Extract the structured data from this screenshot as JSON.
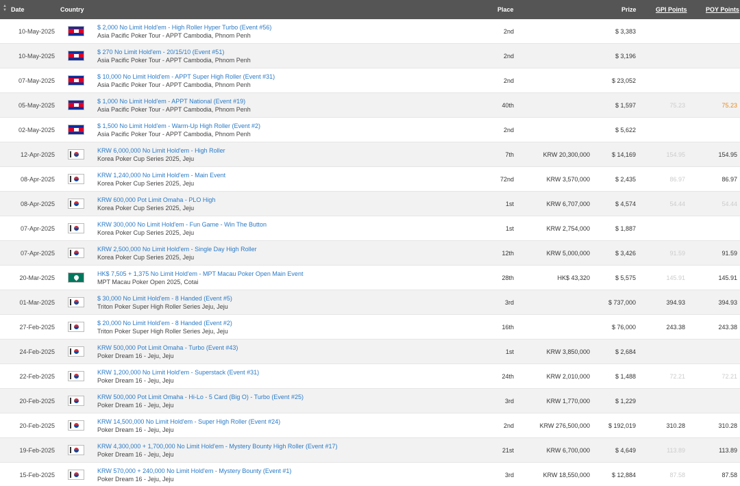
{
  "header": {
    "date": "Date",
    "country": "Country",
    "place": "Place",
    "prize": "Prize",
    "gpi": "GPI Points",
    "poy": "POY Points"
  },
  "rows": [
    {
      "date": "10-May-2025",
      "flag": "kh",
      "event": "$ 2,000 No Limit Hold'em - High Roller Hyper Turbo (Event #56)",
      "tour": "Asia Pacific Poker Tour - APPT Cambodia, Phnom Penh",
      "place": "2nd",
      "local": "",
      "prize": "$ 3,383",
      "gpi": "",
      "poy": ""
    },
    {
      "date": "10-May-2025",
      "flag": "kh",
      "event": "$ 270 No Limit Hold'em - 20/15/10 (Event #51)",
      "tour": "Asia Pacific Poker Tour - APPT Cambodia, Phnom Penh",
      "place": "2nd",
      "local": "",
      "prize": "$ 3,196",
      "gpi": "",
      "poy": ""
    },
    {
      "date": "07-May-2025",
      "flag": "kh",
      "event": "$ 10,000 No Limit Hold'em - APPT Super High Roller (Event #31)",
      "tour": "Asia Pacific Poker Tour - APPT Cambodia, Phnom Penh",
      "place": "2nd",
      "local": "",
      "prize": "$ 23,052",
      "gpi": "",
      "poy": ""
    },
    {
      "date": "05-May-2025",
      "flag": "kh",
      "event": "$ 1,000 No Limit Hold'em - APPT National (Event #19)",
      "tour": "Asia Pacific Poker Tour - APPT Cambodia, Phnom Penh",
      "place": "40th",
      "local": "",
      "prize": "$ 1,597",
      "gpi": "75.23",
      "gpi_faded": true,
      "poy": "75.23",
      "poy_orange": true
    },
    {
      "date": "02-May-2025",
      "flag": "kh",
      "event": "$ 1,500 No Limit Hold'em - Warm-Up High Roller (Event #2)",
      "tour": "Asia Pacific Poker Tour - APPT Cambodia, Phnom Penh",
      "place": "2nd",
      "local": "",
      "prize": "$ 5,622",
      "gpi": "",
      "poy": ""
    },
    {
      "date": "12-Apr-2025",
      "flag": "kr",
      "event": "KRW 6,000,000 No Limit Hold'em - High Roller",
      "tour": "Korea Poker Cup Series 2025, Jeju",
      "place": "7th",
      "local": "KRW 20,300,000",
      "prize": "$ 14,169",
      "gpi": "154.95",
      "gpi_faded": true,
      "poy": "154.95"
    },
    {
      "date": "08-Apr-2025",
      "flag": "kr",
      "event": "KRW 1,240,000 No Limit Hold'em - Main Event",
      "tour": "Korea Poker Cup Series 2025, Jeju",
      "place": "72nd",
      "local": "KRW 3,570,000",
      "prize": "$ 2,435",
      "gpi": "86.97",
      "gpi_faded": true,
      "poy": "86.97"
    },
    {
      "date": "08-Apr-2025",
      "flag": "kr",
      "event": "KRW 600,000 Pot Limit Omaha - PLO High",
      "tour": "Korea Poker Cup Series 2025, Jeju",
      "place": "1st",
      "local": "KRW 6,707,000",
      "prize": "$ 4,574",
      "gpi": "54.44",
      "gpi_faded": true,
      "poy": "54.44",
      "poy_faded": true
    },
    {
      "date": "07-Apr-2025",
      "flag": "kr",
      "event": "KRW 300,000 No Limit Hold'em - Fun Game - Win The Button",
      "tour": "Korea Poker Cup Series 2025, Jeju",
      "place": "1st",
      "local": "KRW 2,754,000",
      "prize": "$ 1,887",
      "gpi": "",
      "poy": ""
    },
    {
      "date": "07-Apr-2025",
      "flag": "kr",
      "event": "KRW 2,500,000 No Limit Hold'em - Single Day High Roller",
      "tour": "Korea Poker Cup Series 2025, Jeju",
      "place": "12th",
      "local": "KRW 5,000,000",
      "prize": "$ 3,426",
      "gpi": "91.59",
      "gpi_faded": true,
      "poy": "91.59"
    },
    {
      "date": "20-Mar-2025",
      "flag": "mo",
      "event": "HK$ 7,505 + 1,375 No Limit Hold'em - MPT Macau Poker Open Main Event",
      "tour": "MPT Macau Poker Open 2025, Cotai",
      "place": "28th",
      "local": "HK$ 43,320",
      "prize": "$ 5,575",
      "gpi": "145.91",
      "gpi_faded": true,
      "poy": "145.91"
    },
    {
      "date": "01-Mar-2025",
      "flag": "kr",
      "event": "$ 30,000 No Limit Hold'em - 8 Handed (Event #5)",
      "tour": "Triton Poker Super High Roller Series Jeju, Jeju",
      "place": "3rd",
      "local": "",
      "prize": "$ 737,000",
      "gpi": "394.93",
      "poy": "394.93"
    },
    {
      "date": "27-Feb-2025",
      "flag": "kr",
      "event": "$ 20,000 No Limit Hold'em - 8 Handed (Event #2)",
      "tour": "Triton Poker Super High Roller Series Jeju, Jeju",
      "place": "16th",
      "local": "",
      "prize": "$ 76,000",
      "gpi": "243.38",
      "poy": "243.38"
    },
    {
      "date": "24-Feb-2025",
      "flag": "kr",
      "event": "KRW 500,000 Pot Limit Omaha - Turbo (Event #43)",
      "tour": "Poker Dream 16 - Jeju, Jeju",
      "place": "1st",
      "local": "KRW 3,850,000",
      "prize": "$ 2,684",
      "gpi": "",
      "poy": ""
    },
    {
      "date": "22-Feb-2025",
      "flag": "kr",
      "event": "KRW 1,200,000 No Limit Hold'em - Superstack (Event #31)",
      "tour": "Poker Dream 16 - Jeju, Jeju",
      "place": "24th",
      "local": "KRW 2,010,000",
      "prize": "$ 1,488",
      "gpi": "72.21",
      "gpi_faded": true,
      "poy": "72.21",
      "poy_faded": true
    },
    {
      "date": "20-Feb-2025",
      "flag": "kr",
      "event": "KRW 500,000 Pot Limit Omaha - Hi-Lo - 5 Card (Big O) - Turbo (Event #25)",
      "tour": "Poker Dream 16 - Jeju, Jeju",
      "place": "3rd",
      "local": "KRW 1,770,000",
      "prize": "$ 1,229",
      "gpi": "",
      "poy": ""
    },
    {
      "date": "20-Feb-2025",
      "flag": "kr",
      "event": "KRW 14,500,000 No Limit Hold'em - Super High Roller (Event #24)",
      "tour": "Poker Dream 16 - Jeju, Jeju",
      "place": "2nd",
      "local": "KRW 276,500,000",
      "prize": "$ 192,019",
      "gpi": "310.28",
      "poy": "310.28"
    },
    {
      "date": "19-Feb-2025",
      "flag": "kr",
      "event": "KRW 4,300,000 + 1,700,000 No Limit Hold'em - Mystery Bounty High Roller (Event #17)",
      "tour": "Poker Dream 16 - Jeju, Jeju",
      "place": "21st",
      "local": "KRW 6,700,000",
      "prize": "$ 4,649",
      "gpi": "113.89",
      "gpi_faded": true,
      "poy": "113.89"
    },
    {
      "date": "15-Feb-2025",
      "flag": "kr",
      "event": "KRW 570,000 + 240,000 No Limit Hold'em - Mystery Bounty (Event #1)",
      "tour": "Poker Dream 16 - Jeju, Jeju",
      "place": "3rd",
      "local": "KRW 18,550,000",
      "prize": "$ 12,884",
      "gpi": "87.58",
      "gpi_faded": true,
      "poy": "87.58"
    }
  ]
}
